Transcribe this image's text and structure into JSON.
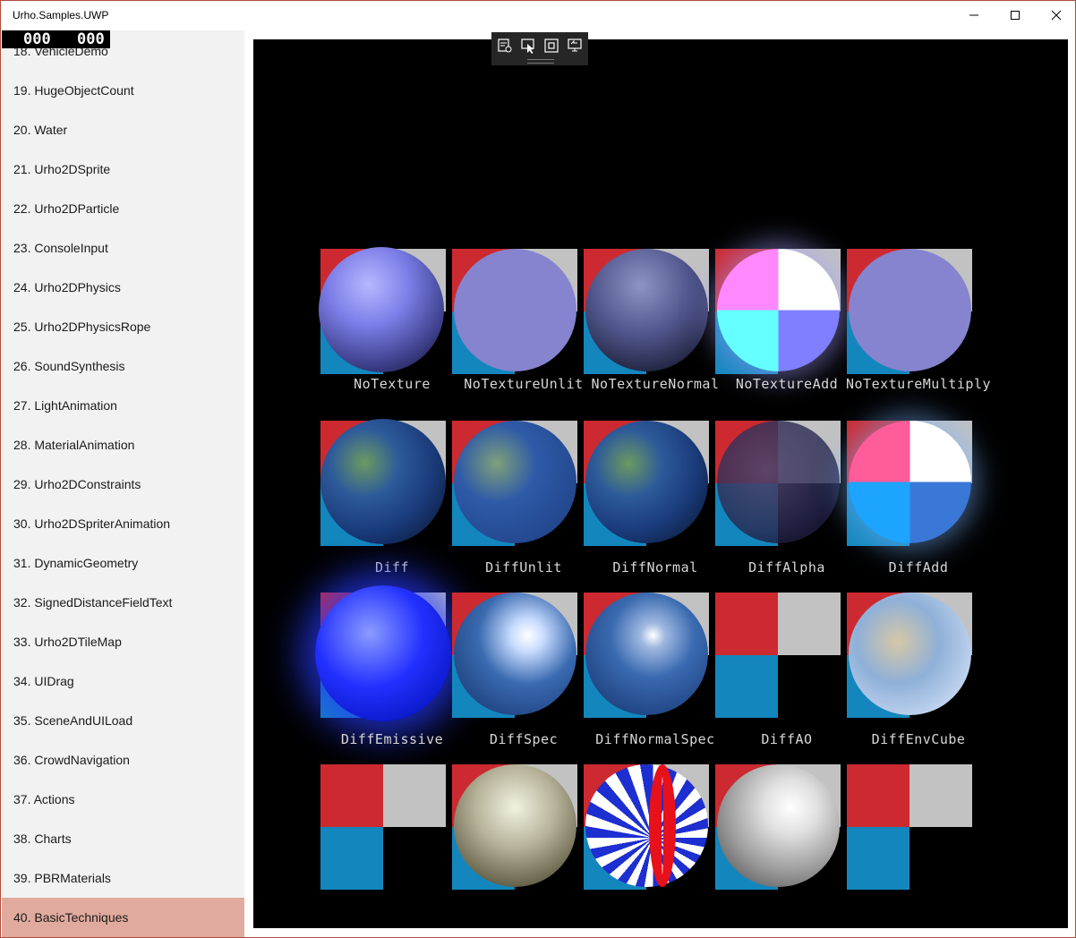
{
  "window": {
    "title": "Urho.Samples.UWP",
    "controls": {
      "minimize": "minimize-icon",
      "maximize": "maximize-icon",
      "close": "close-icon"
    }
  },
  "fps": {
    "left": "000",
    "right": "000"
  },
  "sidebar": {
    "partial_item": "18. VehicleDemo",
    "items": [
      "19. HugeObjectCount",
      "20. Water",
      "21. Urho2DSprite",
      "22. Urho2DParticle",
      "23. ConsoleInput",
      "24. Urho2DPhysics",
      "25. Urho2DPhysicsRope",
      "26. SoundSynthesis",
      "27. LightAnimation",
      "28. MaterialAnimation",
      "29. Urho2DConstraints",
      "30. Urho2DSpriterAnimation",
      "31. DynamicGeometry",
      "32. SignedDistanceFieldText",
      "33. Urho2DTileMap",
      "34. UIDrag",
      "35. SceneAndUILoad",
      "36. CrowdNavigation",
      "37. Actions",
      "38. Charts",
      "39. PBRMaterials",
      "40. BasicTechniques"
    ],
    "selected": "40. BasicTechniques"
  },
  "debug_toolbar": {
    "icons": [
      "visual-tree-icon",
      "select-element-icon",
      "display-layout-adorners-icon",
      "track-focus-icon"
    ]
  },
  "scene": {
    "colors": {
      "red": "#cc2a30",
      "gray": "#c2c2c2",
      "blue": "#1387bd",
      "black": "#000000",
      "label": "#d7d7d7"
    },
    "rows": [
      {
        "labels": [
          "NoTexture",
          "NoTextureUnlit",
          "NoTextureNormal",
          "NoTextureAdd",
          "NoTextureMultiply"
        ]
      },
      {
        "labels": [
          "Diff",
          "DiffUnlit",
          "DiffNormal",
          "DiffAlpha",
          "DiffAdd"
        ]
      },
      {
        "labels": [
          "DiffEmissive",
          "DiffSpec",
          "DiffNormalSpec",
          "DiffAO",
          "DiffEnvCube"
        ]
      },
      {
        "labels": [
          "",
          "",
          "",
          "",
          ""
        ]
      }
    ]
  }
}
